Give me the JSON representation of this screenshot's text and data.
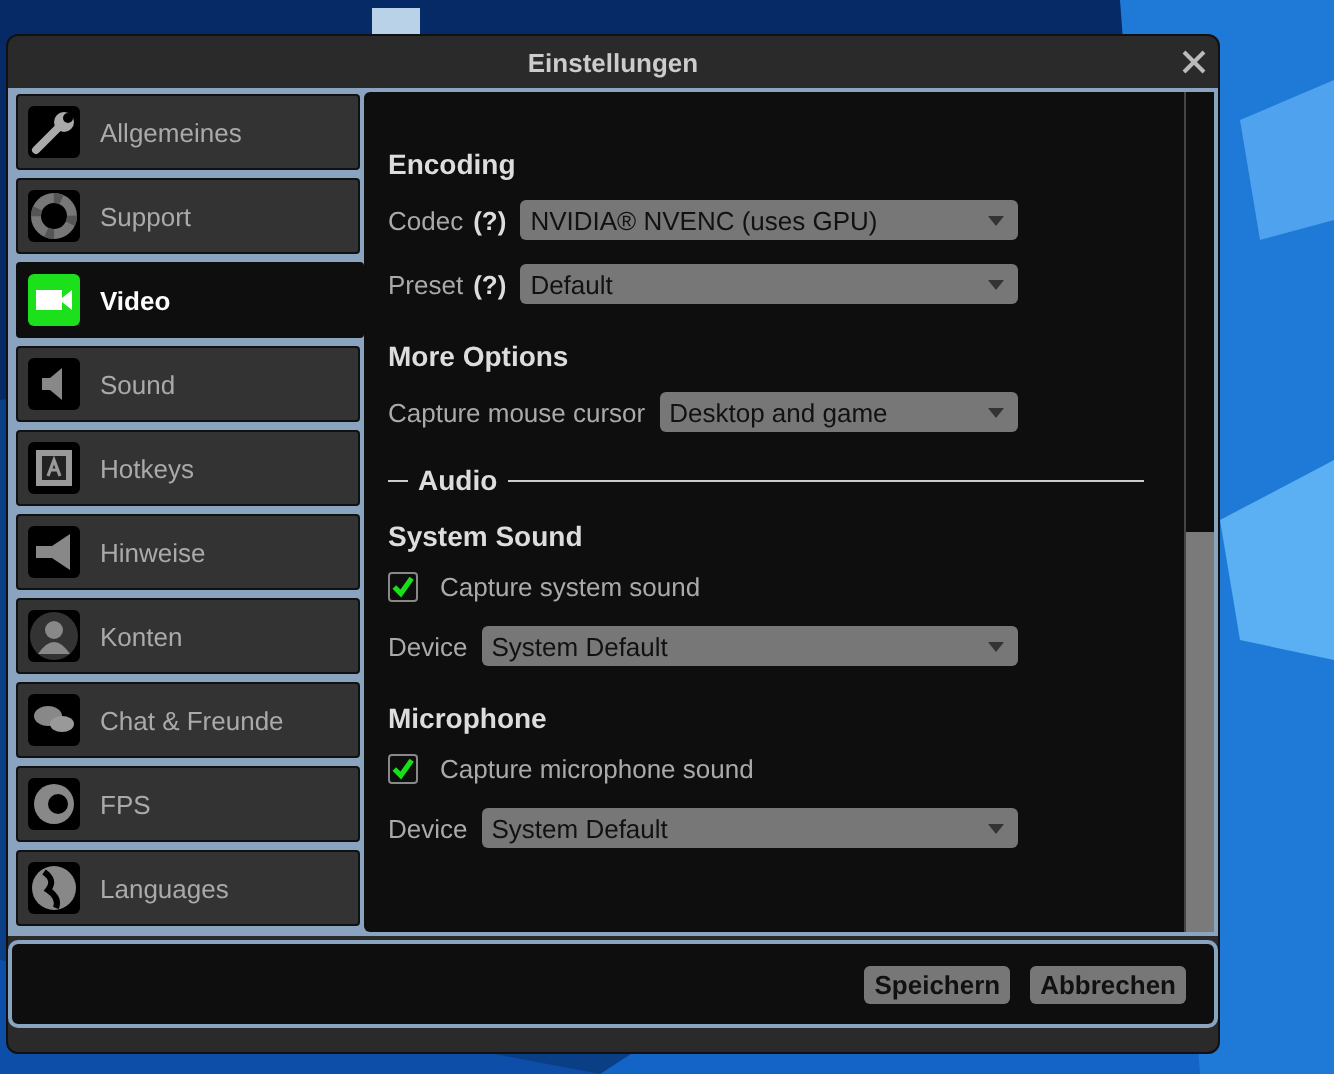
{
  "window": {
    "title": "Einstellungen"
  },
  "sidebar": {
    "items": [
      {
        "label": "Allgemeines",
        "selected": false
      },
      {
        "label": "Support",
        "selected": false
      },
      {
        "label": "Video",
        "selected": true
      },
      {
        "label": "Sound",
        "selected": false
      },
      {
        "label": "Hotkeys",
        "selected": false
      },
      {
        "label": "Hinweise",
        "selected": false
      },
      {
        "label": "Konten",
        "selected": false
      },
      {
        "label": "Chat & Freunde",
        "selected": false
      },
      {
        "label": "FPS",
        "selected": false
      },
      {
        "label": "Languages",
        "selected": false
      }
    ]
  },
  "content": [
    {
      "kind": "heading",
      "text": "Encoding"
    },
    {
      "kind": "select",
      "label": "Codec",
      "help": "(?)",
      "value": "NVIDIA® NVENC (uses GPU)"
    },
    {
      "kind": "select",
      "label": "Preset",
      "help": "(?)",
      "value": "Default"
    },
    {
      "kind": "heading",
      "text": "More Options"
    },
    {
      "kind": "select",
      "label": "Capture mouse cursor",
      "value": "Desktop and game"
    },
    {
      "kind": "divider",
      "text": "Audio"
    },
    {
      "kind": "heading",
      "text": "System Sound"
    },
    {
      "kind": "checkbox",
      "label": "Capture system sound",
      "checked": true
    },
    {
      "kind": "select",
      "label": "Device",
      "value": "System Default"
    },
    {
      "kind": "heading",
      "text": "Microphone"
    },
    {
      "kind": "checkbox",
      "label": "Capture microphone sound",
      "checked": true
    },
    {
      "kind": "select",
      "label": "Device",
      "value": "System Default"
    }
  ],
  "buttons": [
    "Speichern",
    "Abbrechen"
  ]
}
